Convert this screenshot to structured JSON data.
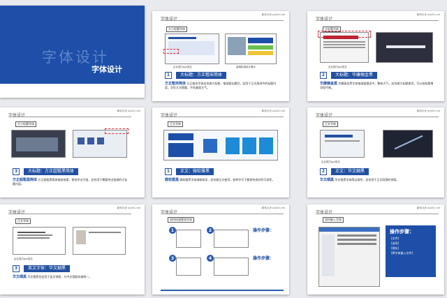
{
  "slides": [
    {
      "big_title": "字体设计",
      "small_title": "字体设计"
    },
    {
      "header": "字体设计",
      "tag": "大小标题字体",
      "caption_left": "企业视力ppt范文",
      "caption_right": "高端机械设计展示",
      "bar_num": "1",
      "bar_label": "大标题：方正粗宋简体",
      "desc_bold": "方正粗宋简体",
      "desc_text": "方正粗宋字体适合做大标题，笔画粗壮醒目，适用于正式演讲中的标题内容，字形大方稳重，不失美观大气。"
    },
    {
      "header": "字体设计",
      "tag": "大标题字体",
      "caption_left": "企业视力ppt范文",
      "bar_num": "2",
      "bar_label": "大标题：华康俪金黑",
      "desc_bold": "华康俪金黑",
      "desc_text": "华康俪金黑字体笔画粗细适中，整体大气，适合做大标题使用，可以给标题增添现代感。"
    },
    {
      "header": "字体设计",
      "tag": "大小标题字体",
      "bar_num": "3",
      "bar_label": "大标题：方正超粗黑简体",
      "desc_bold": "方正超粗黑简体",
      "desc_text": "方正超粗黑简体笔画饱满，视觉冲击力强，适合用于需要突出强调的大标题内容。"
    },
    {
      "header": "字体设计",
      "tag": "正文字体",
      "bar_num": "1",
      "bar_label": "正文：微软雅黑",
      "desc_bold": "微软雅黑",
      "desc_text": "微软雅黑字体清晰易读，适合做正文使用，各种字号下都保持良好的可读性。"
    },
    {
      "header": "字体设计",
      "tag": "正文字体",
      "caption_left": "企业视力ppt范文",
      "bar_num": "2",
      "bar_label": "正文：华文细黑",
      "desc_bold": "华文细黑",
      "desc_text": "华文细黑字体简洁清秀，适合用于正文段落的排版。"
    },
    {
      "header": "字体设计",
      "tag": "正文字体",
      "caption_left": "企业视力ppt范文",
      "bar_num": "3",
      "bar_label": "英文字体：华文细黑",
      "desc_bold": "华文细黑",
      "desc_text": "华文细黑也适用于英文排版，与中文搭配协调统一。"
    },
    {
      "header": "字体设计",
      "tag": "如何快速更改字体",
      "steps_title": "操作步骤：",
      "steps_title2": "操作步骤：",
      "num1": "1",
      "num2": "2",
      "num3": "3",
      "num4": "4"
    },
    {
      "header": "字体设计",
      "tag": "如何嵌入字体",
      "steps_title": "操作步骤：",
      "lines": [
        "[文件]",
        "[选项]",
        "[保存]",
        "[将字体嵌入文件]"
      ]
    }
  ],
  "url": "新科口诀 w.jb51.net"
}
